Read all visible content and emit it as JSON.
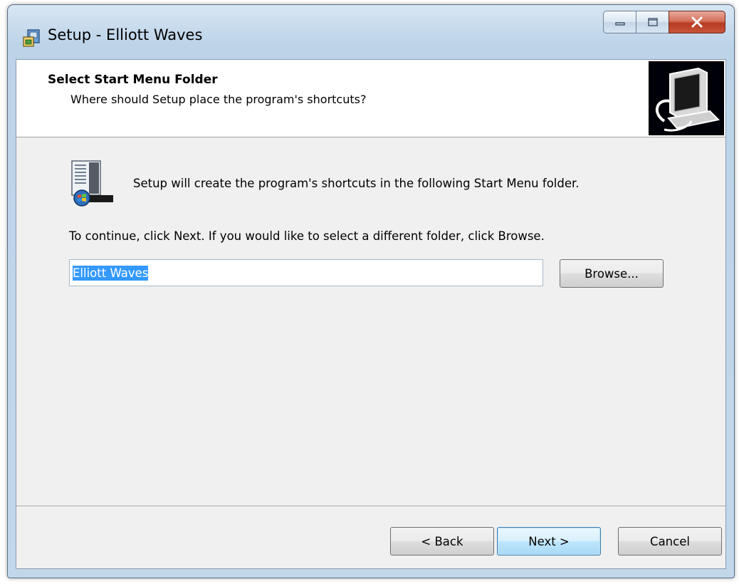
{
  "window": {
    "title": "Setup - Elliott Waves"
  },
  "header": {
    "title": "Select Start Menu Folder",
    "subtitle": "Where should Setup place the program's shortcuts?"
  },
  "body": {
    "line1": "Setup will create the program's shortcuts in the following Start Menu folder.",
    "line2": "To continue, click Next. If you would like to select a different folder, click Browse."
  },
  "folder": {
    "value": "Elliott Waves",
    "selected": true
  },
  "buttons": {
    "browse": "Browse...",
    "back": "< Back",
    "next": "Next >",
    "cancel": "Cancel"
  },
  "icons": {
    "title": "installer-icon",
    "header": "computer-install-icon",
    "body": "start-menu-folder-icon"
  },
  "colors": {
    "selection": "#3399ff",
    "default_button": "#a7d9f5",
    "close_button": "#c8553a"
  }
}
